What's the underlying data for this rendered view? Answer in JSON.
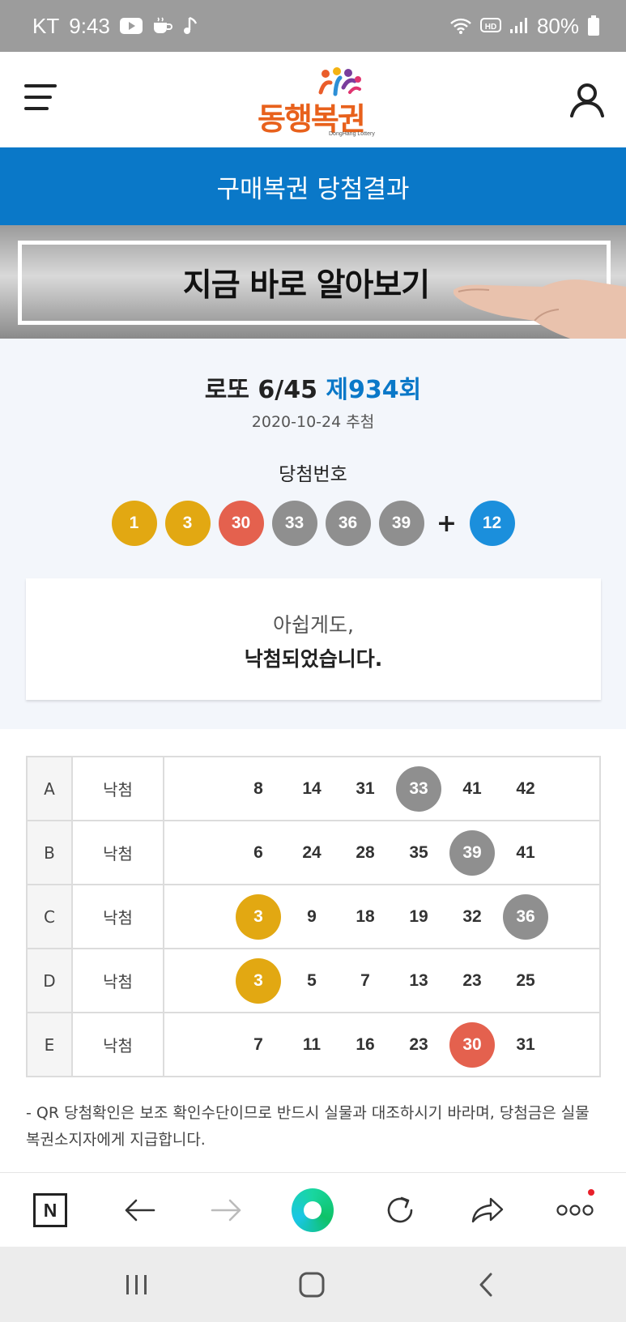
{
  "status_bar": {
    "carrier": "KT",
    "time": "9:43",
    "battery": "80%",
    "icons": [
      "youtube-icon",
      "cafe-icon",
      "music-icon",
      "wifi-icon",
      "hd-icon",
      "signal-icon",
      "battery-icon"
    ]
  },
  "header": {
    "logo_text": "동행복권",
    "logo_subtext": "DongHang Lottery",
    "icons": [
      "menu-icon",
      "user-icon"
    ]
  },
  "page_title": "구매복권 당첨결과",
  "banner": {
    "text": "지금 바로 알아보기"
  },
  "draw": {
    "game": "로또 6/45",
    "round": "제934회",
    "date": "2020-10-24 추첨",
    "winning_label": "당첨번호",
    "numbers": [
      {
        "value": "1",
        "color": "#e2a812"
      },
      {
        "value": "3",
        "color": "#e2a812"
      },
      {
        "value": "30",
        "color": "#e4614e"
      },
      {
        "value": "33",
        "color": "#8f8f8f"
      },
      {
        "value": "36",
        "color": "#8f8f8f"
      },
      {
        "value": "39",
        "color": "#8f8f8f"
      }
    ],
    "plus": "+",
    "bonus": {
      "value": "12",
      "color": "#1b8fdc"
    }
  },
  "message": {
    "line1": "아쉽게도,",
    "line2": "낙첨되었습니다."
  },
  "tickets": [
    {
      "letter": "A",
      "status": "낙첨",
      "numbers": [
        {
          "value": "8",
          "hit": null
        },
        {
          "value": "14",
          "hit": null
        },
        {
          "value": "31",
          "hit": null
        },
        {
          "value": "33",
          "hit": "#8f8f8f"
        },
        {
          "value": "41",
          "hit": null
        },
        {
          "value": "42",
          "hit": null
        }
      ]
    },
    {
      "letter": "B",
      "status": "낙첨",
      "numbers": [
        {
          "value": "6",
          "hit": null
        },
        {
          "value": "24",
          "hit": null
        },
        {
          "value": "28",
          "hit": null
        },
        {
          "value": "35",
          "hit": null
        },
        {
          "value": "39",
          "hit": "#8f8f8f"
        },
        {
          "value": "41",
          "hit": null
        }
      ]
    },
    {
      "letter": "C",
      "status": "낙첨",
      "numbers": [
        {
          "value": "3",
          "hit": "#e2a812"
        },
        {
          "value": "9",
          "hit": null
        },
        {
          "value": "18",
          "hit": null
        },
        {
          "value": "19",
          "hit": null
        },
        {
          "value": "32",
          "hit": null
        },
        {
          "value": "36",
          "hit": "#8f8f8f"
        }
      ]
    },
    {
      "letter": "D",
      "status": "낙첨",
      "numbers": [
        {
          "value": "3",
          "hit": "#e2a812"
        },
        {
          "value": "5",
          "hit": null
        },
        {
          "value": "7",
          "hit": null
        },
        {
          "value": "13",
          "hit": null
        },
        {
          "value": "23",
          "hit": null
        },
        {
          "value": "25",
          "hit": null
        }
      ]
    },
    {
      "letter": "E",
      "status": "낙첨",
      "numbers": [
        {
          "value": "7",
          "hit": null
        },
        {
          "value": "11",
          "hit": null
        },
        {
          "value": "16",
          "hit": null
        },
        {
          "value": "23",
          "hit": null
        },
        {
          "value": "30",
          "hit": "#e4614e"
        },
        {
          "value": "31",
          "hit": null
        }
      ]
    }
  ],
  "notice": "- QR 당첨확인은 보조 확인수단이므로 반드시 실물과 대조하시기 바라며, 당첨금은 실물 복권소지자에게 지급합니다.",
  "browser_toolbar": {
    "n_label": "N",
    "icons": [
      "naver-home-icon",
      "back-arrow-icon",
      "forward-arrow-icon",
      "green-dot-icon",
      "refresh-icon",
      "share-icon",
      "more-icon"
    ]
  },
  "nav_bar": {
    "icons": [
      "recent-apps-icon",
      "home-icon",
      "back-icon"
    ]
  }
}
